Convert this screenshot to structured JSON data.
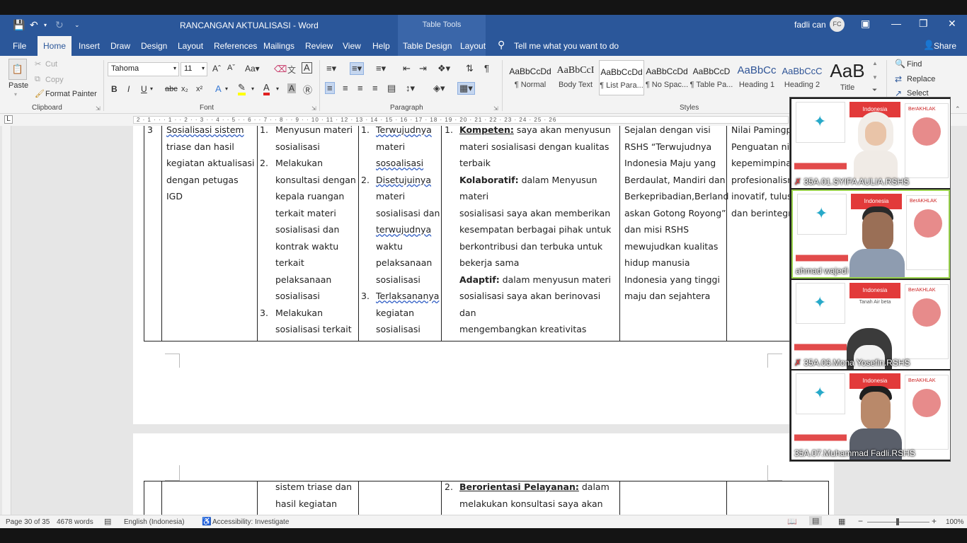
{
  "app": {
    "title": "RANCANGAN AKTUALISASI  -  Word",
    "contextual_group": "Table Tools",
    "user_name": "fadli can",
    "user_initials": "FC"
  },
  "tabs": [
    "File",
    "Home",
    "Insert",
    "Draw",
    "Design",
    "Layout",
    "References",
    "Mailings",
    "Review",
    "View",
    "Help",
    "Table Design",
    "Layout"
  ],
  "tell_me": "Tell me what you want to do",
  "share": "Share",
  "ribbon": {
    "clipboard": {
      "paste": "Paste",
      "cut": "Cut",
      "copy": "Copy",
      "format_painter": "Format Painter",
      "label": "Clipboard"
    },
    "font": {
      "name": "Tahoma",
      "size": "11",
      "label": "Font"
    },
    "paragraph": {
      "label": "Paragraph"
    },
    "styles": {
      "label": "Styles",
      "items": [
        {
          "preview": "AaBbCcDd",
          "name": "¶ Normal"
        },
        {
          "preview": "AaBbCcI",
          "name": "Body Text"
        },
        {
          "preview": "AaBbCcDd",
          "name": "¶ List Para..."
        },
        {
          "preview": "AaBbCcDd",
          "name": "¶ No Spac..."
        },
        {
          "preview": "AaBbCcD",
          "name": "¶ Table Pa..."
        },
        {
          "preview": "AaBbCc",
          "name": "Heading 1"
        },
        {
          "preview": "AaBbCcC",
          "name": "Heading 2"
        },
        {
          "preview": "AaB",
          "name": "Title"
        }
      ]
    },
    "editing": {
      "find": "Find",
      "replace": "Replace",
      "select": "Select"
    }
  },
  "ruler_text": "2 · 1 · · · 1 · · 2 · · 3 · · 4 · · 5 · · 6 · · 7 · · 8 · · 9 · · 10 · 11 · 12 · 13 · 14 · 15 · 16 · 17 · 18 · 19 · 20 · 21 · 22 · 23 · 24 · 25 · 26",
  "table": {
    "no": "3",
    "kegiatan": [
      "Sosialisasi sistem",
      "triase dan hasil",
      "kegiatan aktualisasi",
      "dengan petugas IGD"
    ],
    "tahapan": [
      {
        "num": "1.",
        "lines": [
          "Menyusun materi",
          "sosialisasi"
        ]
      },
      {
        "num": "2.",
        "lines": [
          "Melakukan",
          "konsultasi dengan",
          "kepala ruangan",
          "terkait materi",
          "sosialisasi dan",
          "kontrak waktu",
          "terkait",
          "pelaksanaan",
          "sosialisasi"
        ]
      },
      {
        "num": "3.",
        "lines": [
          "Melakukan",
          "sosialisasi terkait"
        ]
      }
    ],
    "output": [
      {
        "num": "1.",
        "lines": [
          "Terwujudnya",
          "materi",
          "sosoalisasi"
        ]
      },
      {
        "num": "2.",
        "lines": [
          "Disetujuinya",
          "materi",
          "sosialisasi dan",
          "terwujudnya",
          "waktu",
          "pelaksanaan",
          "sosialisasi"
        ]
      },
      {
        "num": "3.",
        "lines": [
          "Terlaksananya",
          "kegiatan",
          "sosialisasi"
        ]
      }
    ],
    "nilai": {
      "num": "1.",
      "kompeten_label": "Kompeten:",
      "kompeten_rest": " saya akan menyusun",
      "lines1": [
        "materi sosialisasi dengan kualitas",
        "terbaik"
      ],
      "kolaboratif_label": "Kolaboratif:",
      "kolaboratif_rest": " dalam Menyusun materi",
      "lines2": [
        "sosialisasi saya akan memberikan",
        "kesempatan berbagai pihak untuk",
        "berkontribusi dan terbuka untuk",
        "bekerja sama"
      ],
      "adaptif_label": "Adaptif:",
      "adaptif_rest": " dalam menyusun materi",
      "lines3": [
        "sosialisasi saya akan berinovasi dan",
        "mengembangkan kreativitas"
      ]
    },
    "visi": [
      "Sejalan dengan visi",
      "RSHS “Terwujudnya",
      "Indonesia Maju yang",
      "Berdaulat, Mandiri dan",
      "Berkepribadian,Berland",
      "askan Gotong Royong”",
      "dan misi RSHS",
      "mewujudkan kualitas",
      "hidup manusia",
      "Indonesia yang tinggi",
      "maju dan sejahtera"
    ],
    "penguatan": [
      "Nilai Pamingpi",
      "Penguatan nila",
      "kepemimpinan",
      "profesionalism",
      "inovatif, tulus,",
      "dan berintegri"
    ]
  },
  "table2": {
    "tahapan": [
      "sistem triase dan",
      "hasil kegiatan"
    ],
    "nilai_num": "2.",
    "nilai_label": "Berorientasi Pelayanan:",
    "nilai_rest": " dalam",
    "nilai_line2": "melakukan konsultasi saya akan"
  },
  "video": [
    {
      "name": "35A.01.SYIFA AULIA.RSHS",
      "muted": true,
      "active": false
    },
    {
      "name": "ahmad wajedi",
      "muted": false,
      "active": true
    },
    {
      "name": "35A.06.Mona Yosefin.RSHS",
      "muted": true,
      "active": false
    },
    {
      "name": "35A.07.Muhammad Fadli.RSHS",
      "muted": false,
      "active": false
    }
  ],
  "video_slide_text": {
    "banner": "Indonesia",
    "banner2": "Tanah Air beta",
    "berakhlak": "BerAKHLAK"
  },
  "status": {
    "page": "Page 30 of 35",
    "words": "4678 words",
    "language": "English (Indonesia)",
    "accessibility": "Accessibility: Investigate",
    "zoom": "100%"
  }
}
